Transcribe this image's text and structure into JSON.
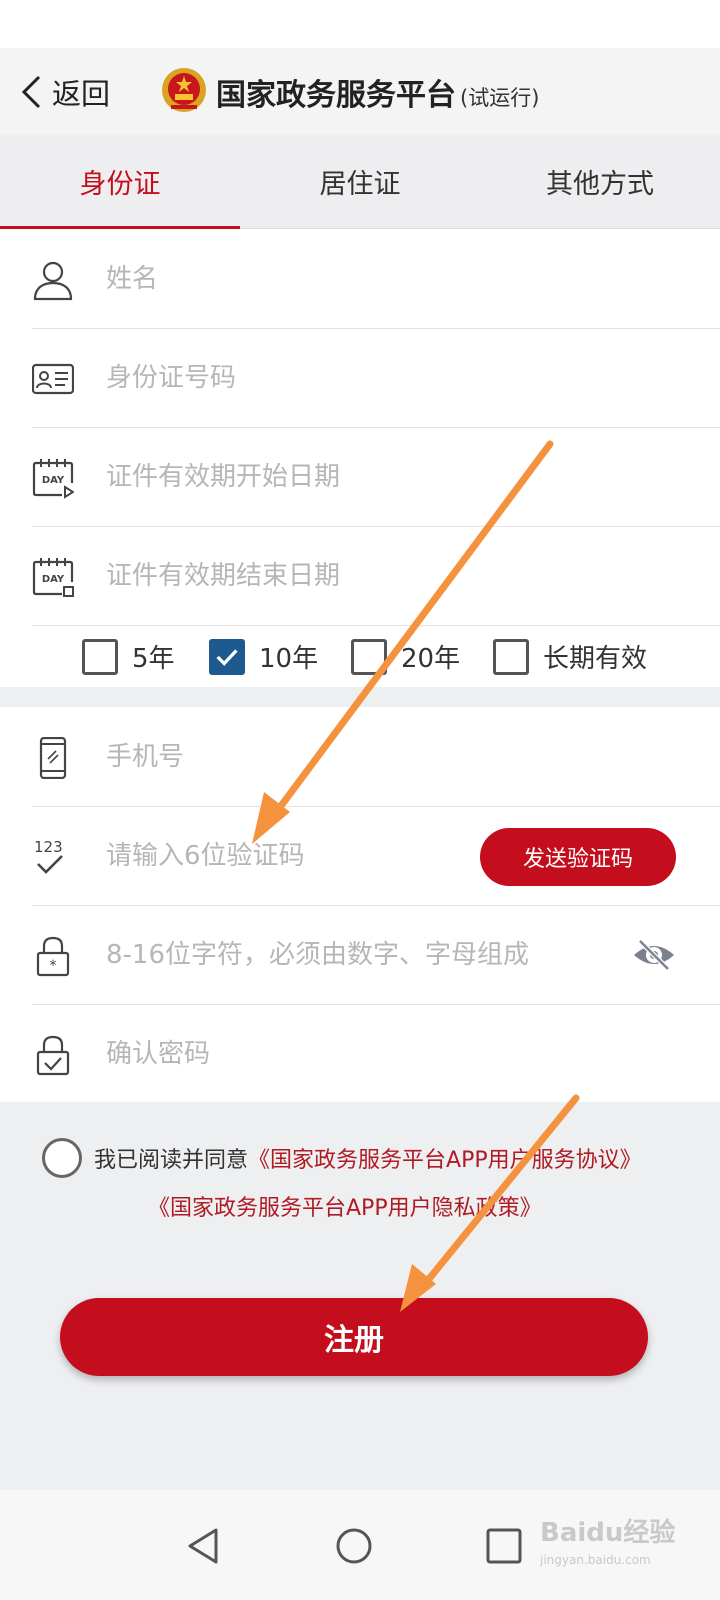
{
  "header": {
    "back_label": "返回",
    "title": "国家政务服务平台",
    "title_suffix": "(试运行)"
  },
  "tabs": [
    {
      "label": "身份证",
      "active": true
    },
    {
      "label": "居住证",
      "active": false
    },
    {
      "label": "其他方式",
      "active": false
    }
  ],
  "identity_form": {
    "name_placeholder": "姓名",
    "id_number_placeholder": "身份证号码",
    "start_date_placeholder": "证件有效期开始日期",
    "end_date_placeholder": "证件有效期结束日期"
  },
  "validity_options": [
    {
      "label": "5年",
      "checked": false
    },
    {
      "label": "10年",
      "checked": true
    },
    {
      "label": "20年",
      "checked": false
    },
    {
      "label": "长期有效",
      "checked": false
    }
  ],
  "account_form": {
    "phone_placeholder": "手机号",
    "code_placeholder": "请输入6位验证码",
    "send_code_label": "发送验证码",
    "password_placeholder": "8-16位字符，必须由数字、字母组成",
    "confirm_placeholder": "确认密码"
  },
  "agreement": {
    "prefix": "我已阅读并同意",
    "service_link": "《国家政务服务平台APP用户服务协议》",
    "privacy_link": "《国家政务服务平台APP用户隐私政策》",
    "checked": false
  },
  "register_label": "注册",
  "watermark": {
    "brand": "Baidu经验",
    "url": "jingyan.baidu.com"
  },
  "colors": {
    "accent": "#c40d1d",
    "link": "#b01a22",
    "checkbox_checked": "#1d5a8f",
    "annotation_arrow": "#f5923e"
  }
}
